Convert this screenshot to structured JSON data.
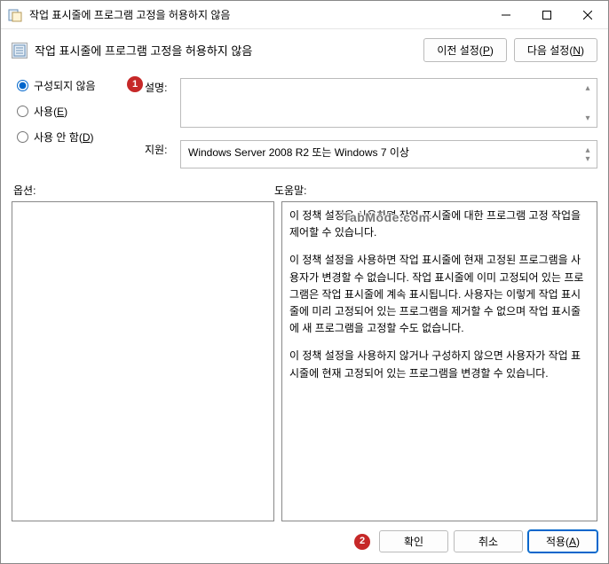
{
  "window": {
    "title": "작업 표시줄에 프로그램 고정을 허용하지 않음"
  },
  "header": {
    "title": "작업 표시줄에 프로그램 고정을 허용하지 않음",
    "prev_label": "이전 설정(P)",
    "next_label": "다음 설정(N)"
  },
  "radio": {
    "not_configured": "구성되지 않음",
    "enabled": "사용(E)",
    "disabled": "사용 안 함(D)"
  },
  "fields": {
    "description_label": "설명:",
    "description_value": "",
    "support_label": "지원:",
    "support_value": "Windows Server 2008 R2 또는 Windows 7 이상"
  },
  "columns": {
    "options": "옵션:",
    "help": "도움말:"
  },
  "help": {
    "p1": "이 정책 설정을 사용하면 작업 표시줄에 대한 프로그램 고정 작업을 제어할 수 있습니다.",
    "p2": "이 정책 설정을 사용하면 작업 표시줄에 현재 고정된 프로그램을 사용자가 변경할 수 없습니다. 작업 표시줄에 이미 고정되어 있는 프로그램은 작업 표시줄에 계속 표시됩니다. 사용자는 이렇게 작업 표시줄에 미리 고정되어 있는 프로그램을 제거할 수 없으며 작업 표시줄에 새 프로그램을 고정할 수도 없습니다.",
    "p3": "이 정책 설정을 사용하지 않거나 구성하지 않으면 사용자가 작업 표시줄에 현재 고정되어 있는 프로그램을 변경할 수 있습니다."
  },
  "footer": {
    "ok": "확인",
    "cancel": "취소",
    "apply": "적용(A)"
  },
  "annotations": {
    "a1": "1",
    "a2": "2"
  },
  "watermark": "TabMode.com"
}
